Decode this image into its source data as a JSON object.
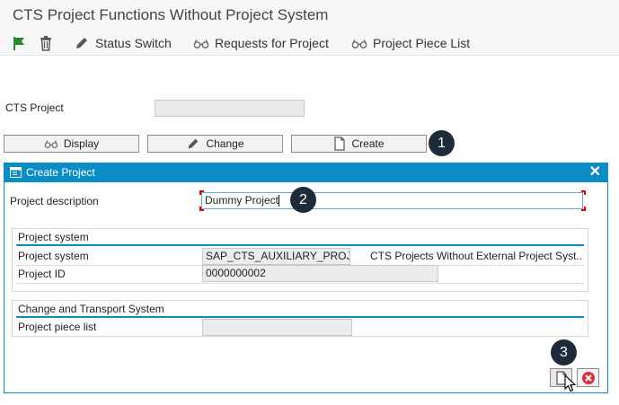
{
  "window": {
    "title": "CTS Project Functions Without Project System"
  },
  "toolbar": {
    "status_switch": "Status Switch",
    "requests_for_project": "Requests for Project",
    "project_piece_list": "Project Piece List"
  },
  "main": {
    "cts_project_label": "CTS Project",
    "cts_project_value": "",
    "display_label": "Display",
    "change_label": "Change",
    "create_label": "Create"
  },
  "dialog": {
    "title": "Create Project",
    "project_description_label": "Project description",
    "project_description_value": "Dummy Project",
    "group_project_system": {
      "title": "Project system",
      "project_system_label": "Project system",
      "project_system_value": "SAP_CTS_AUXILIARY_PROJE..",
      "project_system_text": "CTS Projects Without External Project Syst..",
      "project_id_label": "Project ID",
      "project_id_value": "0000000002"
    },
    "group_cts": {
      "title": "Change and Transport System",
      "project_piece_list_label": "Project piece list",
      "project_piece_list_value": ""
    }
  },
  "badges": {
    "one": "1",
    "two": "2",
    "three": "3"
  },
  "colors": {
    "accent": "#0a8cc4",
    "badge": "#1e2b3b",
    "cancel": "#d9303a",
    "flag": "#2a8a2a"
  },
  "icons": [
    "flag-icon",
    "trash-icon",
    "pencil-icon",
    "glasses-icon",
    "document-icon",
    "close-icon",
    "cancel-icon",
    "mouse-cursor-icon"
  ]
}
